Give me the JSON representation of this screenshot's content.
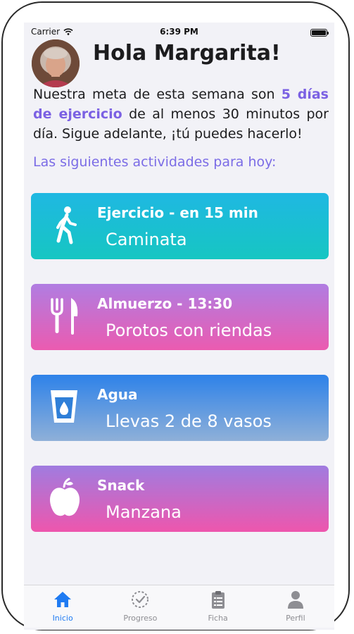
{
  "status_bar": {
    "carrier": "Carrier",
    "time": "6:39 PM"
  },
  "header": {
    "title": "Hola Margarita!"
  },
  "intro": {
    "part1": "Nuestra meta de esta semana son ",
    "highlight": "5 días de ejercicio",
    "part2": " de al menos 30 minutos por día. Sigue adelante, ¡tú puedes hacerlo!"
  },
  "subheading": "Las siguientes actividades para hoy:",
  "activities": [
    {
      "icon": "walking-person-icon",
      "label": "Ejercicio - en 15 min",
      "value": "Caminata"
    },
    {
      "icon": "fork-knife-icon",
      "label": "Almuerzo - 13:30",
      "value": "Porotos con riendas"
    },
    {
      "icon": "water-glass-icon",
      "label": "Agua",
      "value": "Llevas 2 de 8 vasos",
      "glasses_done": 2,
      "glasses_goal": 8
    },
    {
      "icon": "apple-icon",
      "label": "Snack",
      "value": "Manzana"
    }
  ],
  "tabbar": {
    "tabs": [
      {
        "label": "Inicio",
        "icon": "home-icon",
        "active": true
      },
      {
        "label": "Progreso",
        "icon": "progress-clock-icon",
        "active": false
      },
      {
        "label": "Ficha",
        "icon": "clipboard-icon",
        "active": false
      },
      {
        "label": "Perfil",
        "icon": "person-icon",
        "active": false
      }
    ]
  },
  "colors": {
    "accent": "#1f7bf2",
    "highlight": "#7b61e3",
    "card_exercise": "#1fb8e2",
    "card_lunch": "#eb5bb0",
    "card_water": "#2e82e9",
    "card_snack": "#ee56ad"
  }
}
